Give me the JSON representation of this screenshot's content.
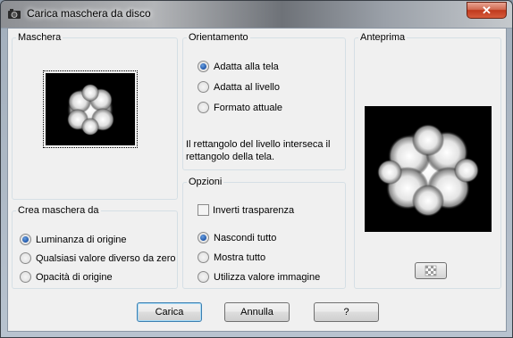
{
  "window": {
    "title": "Carica maschera da disco",
    "close_label": "✕"
  },
  "maschera": {
    "legend": "Maschera"
  },
  "crea": {
    "legend": "Crea maschera da",
    "options": [
      "Luminanza di origine",
      "Qualsiasi valore diverso da zero",
      "Opacità di origine"
    ],
    "selected": 0
  },
  "orientamento": {
    "legend": "Orientamento",
    "options": [
      "Adatta alla tela",
      "Adatta al livello",
      "Formato attuale"
    ],
    "selected": 0,
    "note": "Il rettangolo del livello interseca il rettangolo della tela."
  },
  "opzioni": {
    "legend": "Opzioni",
    "invert_label": "Inverti trasparenza",
    "invert_checked": false,
    "options": [
      "Nascondi tutto",
      "Mostra tutto",
      "Utilizza valore immagine"
    ],
    "selected": 0
  },
  "anteprima": {
    "legend": "Anteprima"
  },
  "buttons": {
    "load": "Carica",
    "cancel": "Annulla",
    "help": "?"
  }
}
